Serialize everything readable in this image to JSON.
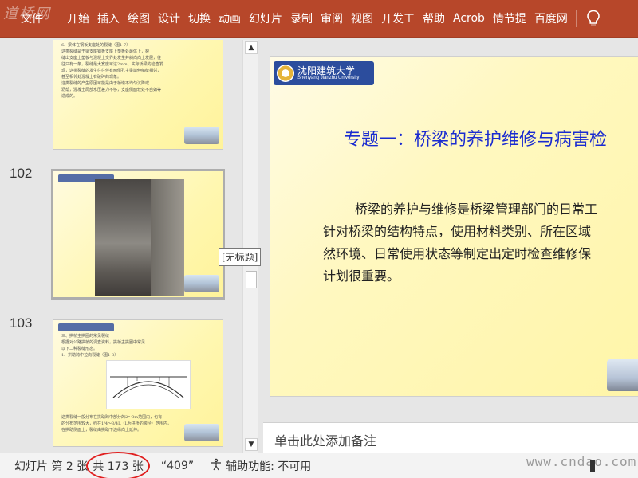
{
  "ribbon": {
    "watermark_logo": "道桥网",
    "file_tab": "文件",
    "tabs": [
      "开始",
      "插入",
      "绘图",
      "设计",
      "切换",
      "动画",
      "幻灯片",
      "录制",
      "审阅",
      "视图",
      "开发工",
      "帮助",
      "Acrob",
      "情节提",
      "百度网"
    ],
    "bulb_icon": "lightbulb-icon",
    "color": "#b7472a"
  },
  "thumbnails": {
    "items": [
      {
        "number": "",
        "lines": [
          "6、梁体在钢板支座处的裂缝（图1-7）",
          "这类裂缝是于梁支座钢板支座上垫板处最体上，裂",
          "缝出支座上垫板与混凝土交界处发生并斜向向上发展，往",
          "往只有一条，裂缝最大宽度可达2mm。实际桥梁的检查发",
          "现，这类裂缝的发生往往伴有两侧孔主梁端伸缩缝相邻，",
          "甚至相邻处混凝土有破碎的现象。",
          "这类裂缝的产生原因可能是由于桥墩不均匀沉降或",
          "沥帮，混凝土局部水压差力不够，支座侧面较处不自如等",
          "造成的。"
        ]
      },
      {
        "number": "102",
        "lines": []
      },
      {
        "number": "103",
        "lines": [
          "三、拱桥主拱圈的常见裂缝",
          "根据对公路拱桥的调查资料，拱桥主拱圈中常见",
          "以下二种裂缝形态。",
          "1、拱助跨中拉向裂缝（图1-8）",
          "这类裂缝一般分布在拱助跨中部分的2～3m范围内，也有",
          "的分布范围较大，约在1/4～3/4L（L为拱桥的跨径）范围内，",
          "在拱助侧面上，裂缝由拱助下边缘向上延伸。"
        ]
      }
    ],
    "tooltip": "[无标题]"
  },
  "scrollbar": {
    "up_icon": "scroll-up-icon",
    "down_icon": "scroll-down-icon"
  },
  "slide": {
    "logo_cn": "沈阳建筑大学",
    "logo_en": "Shenyang Jianzhu University",
    "title": "专题一：桥梁的养护维修与病害检",
    "body": [
      "桥梁的养护与维修是桥梁管理部门的日常工",
      "针对桥梁的结构特点，使用材料类别、所在区域",
      "然环境、日常使用状态等制定出定时检查维修保",
      "计划很重要。"
    ],
    "title_color": "#1a2bd0"
  },
  "notes": {
    "placeholder": "单击此处添加备注"
  },
  "status": {
    "slide_info": "幻灯片 第 2 张",
    "total": "共 173 张",
    "language": "“409”",
    "accessibility": "辅助功能: 不可用",
    "watermark": "www.cndao.com",
    "circle_color": "#e02020"
  }
}
